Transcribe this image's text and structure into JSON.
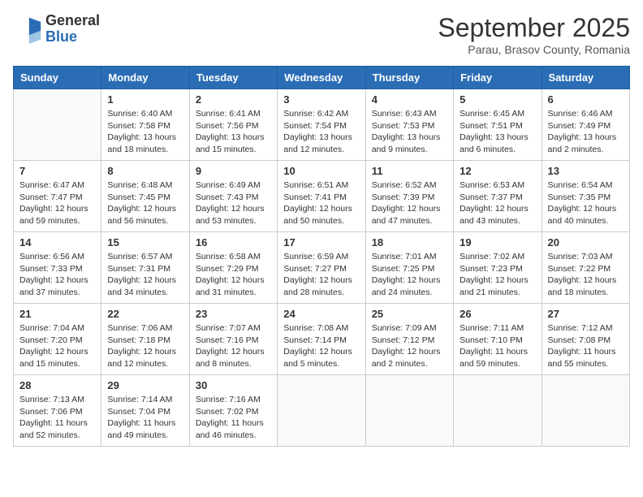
{
  "header": {
    "logo_general": "General",
    "logo_blue": "Blue",
    "month_title": "September 2025",
    "subtitle": "Parau, Brasov County, Romania"
  },
  "days_of_week": [
    "Sunday",
    "Monday",
    "Tuesday",
    "Wednesday",
    "Thursday",
    "Friday",
    "Saturday"
  ],
  "weeks": [
    [
      {
        "day": "",
        "info": ""
      },
      {
        "day": "1",
        "info": "Sunrise: 6:40 AM\nSunset: 7:58 PM\nDaylight: 13 hours\nand 18 minutes."
      },
      {
        "day": "2",
        "info": "Sunrise: 6:41 AM\nSunset: 7:56 PM\nDaylight: 13 hours\nand 15 minutes."
      },
      {
        "day": "3",
        "info": "Sunrise: 6:42 AM\nSunset: 7:54 PM\nDaylight: 13 hours\nand 12 minutes."
      },
      {
        "day": "4",
        "info": "Sunrise: 6:43 AM\nSunset: 7:53 PM\nDaylight: 13 hours\nand 9 minutes."
      },
      {
        "day": "5",
        "info": "Sunrise: 6:45 AM\nSunset: 7:51 PM\nDaylight: 13 hours\nand 6 minutes."
      },
      {
        "day": "6",
        "info": "Sunrise: 6:46 AM\nSunset: 7:49 PM\nDaylight: 13 hours\nand 2 minutes."
      }
    ],
    [
      {
        "day": "7",
        "info": "Sunrise: 6:47 AM\nSunset: 7:47 PM\nDaylight: 12 hours\nand 59 minutes."
      },
      {
        "day": "8",
        "info": "Sunrise: 6:48 AM\nSunset: 7:45 PM\nDaylight: 12 hours\nand 56 minutes."
      },
      {
        "day": "9",
        "info": "Sunrise: 6:49 AM\nSunset: 7:43 PM\nDaylight: 12 hours\nand 53 minutes."
      },
      {
        "day": "10",
        "info": "Sunrise: 6:51 AM\nSunset: 7:41 PM\nDaylight: 12 hours\nand 50 minutes."
      },
      {
        "day": "11",
        "info": "Sunrise: 6:52 AM\nSunset: 7:39 PM\nDaylight: 12 hours\nand 47 minutes."
      },
      {
        "day": "12",
        "info": "Sunrise: 6:53 AM\nSunset: 7:37 PM\nDaylight: 12 hours\nand 43 minutes."
      },
      {
        "day": "13",
        "info": "Sunrise: 6:54 AM\nSunset: 7:35 PM\nDaylight: 12 hours\nand 40 minutes."
      }
    ],
    [
      {
        "day": "14",
        "info": "Sunrise: 6:56 AM\nSunset: 7:33 PM\nDaylight: 12 hours\nand 37 minutes."
      },
      {
        "day": "15",
        "info": "Sunrise: 6:57 AM\nSunset: 7:31 PM\nDaylight: 12 hours\nand 34 minutes."
      },
      {
        "day": "16",
        "info": "Sunrise: 6:58 AM\nSunset: 7:29 PM\nDaylight: 12 hours\nand 31 minutes."
      },
      {
        "day": "17",
        "info": "Sunrise: 6:59 AM\nSunset: 7:27 PM\nDaylight: 12 hours\nand 28 minutes."
      },
      {
        "day": "18",
        "info": "Sunrise: 7:01 AM\nSunset: 7:25 PM\nDaylight: 12 hours\nand 24 minutes."
      },
      {
        "day": "19",
        "info": "Sunrise: 7:02 AM\nSunset: 7:23 PM\nDaylight: 12 hours\nand 21 minutes."
      },
      {
        "day": "20",
        "info": "Sunrise: 7:03 AM\nSunset: 7:22 PM\nDaylight: 12 hours\nand 18 minutes."
      }
    ],
    [
      {
        "day": "21",
        "info": "Sunrise: 7:04 AM\nSunset: 7:20 PM\nDaylight: 12 hours\nand 15 minutes."
      },
      {
        "day": "22",
        "info": "Sunrise: 7:06 AM\nSunset: 7:18 PM\nDaylight: 12 hours\nand 12 minutes."
      },
      {
        "day": "23",
        "info": "Sunrise: 7:07 AM\nSunset: 7:16 PM\nDaylight: 12 hours\nand 8 minutes."
      },
      {
        "day": "24",
        "info": "Sunrise: 7:08 AM\nSunset: 7:14 PM\nDaylight: 12 hours\nand 5 minutes."
      },
      {
        "day": "25",
        "info": "Sunrise: 7:09 AM\nSunset: 7:12 PM\nDaylight: 12 hours\nand 2 minutes."
      },
      {
        "day": "26",
        "info": "Sunrise: 7:11 AM\nSunset: 7:10 PM\nDaylight: 11 hours\nand 59 minutes."
      },
      {
        "day": "27",
        "info": "Sunrise: 7:12 AM\nSunset: 7:08 PM\nDaylight: 11 hours\nand 55 minutes."
      }
    ],
    [
      {
        "day": "28",
        "info": "Sunrise: 7:13 AM\nSunset: 7:06 PM\nDaylight: 11 hours\nand 52 minutes."
      },
      {
        "day": "29",
        "info": "Sunrise: 7:14 AM\nSunset: 7:04 PM\nDaylight: 11 hours\nand 49 minutes."
      },
      {
        "day": "30",
        "info": "Sunrise: 7:16 AM\nSunset: 7:02 PM\nDaylight: 11 hours\nand 46 minutes."
      },
      {
        "day": "",
        "info": ""
      },
      {
        "day": "",
        "info": ""
      },
      {
        "day": "",
        "info": ""
      },
      {
        "day": "",
        "info": ""
      }
    ]
  ]
}
